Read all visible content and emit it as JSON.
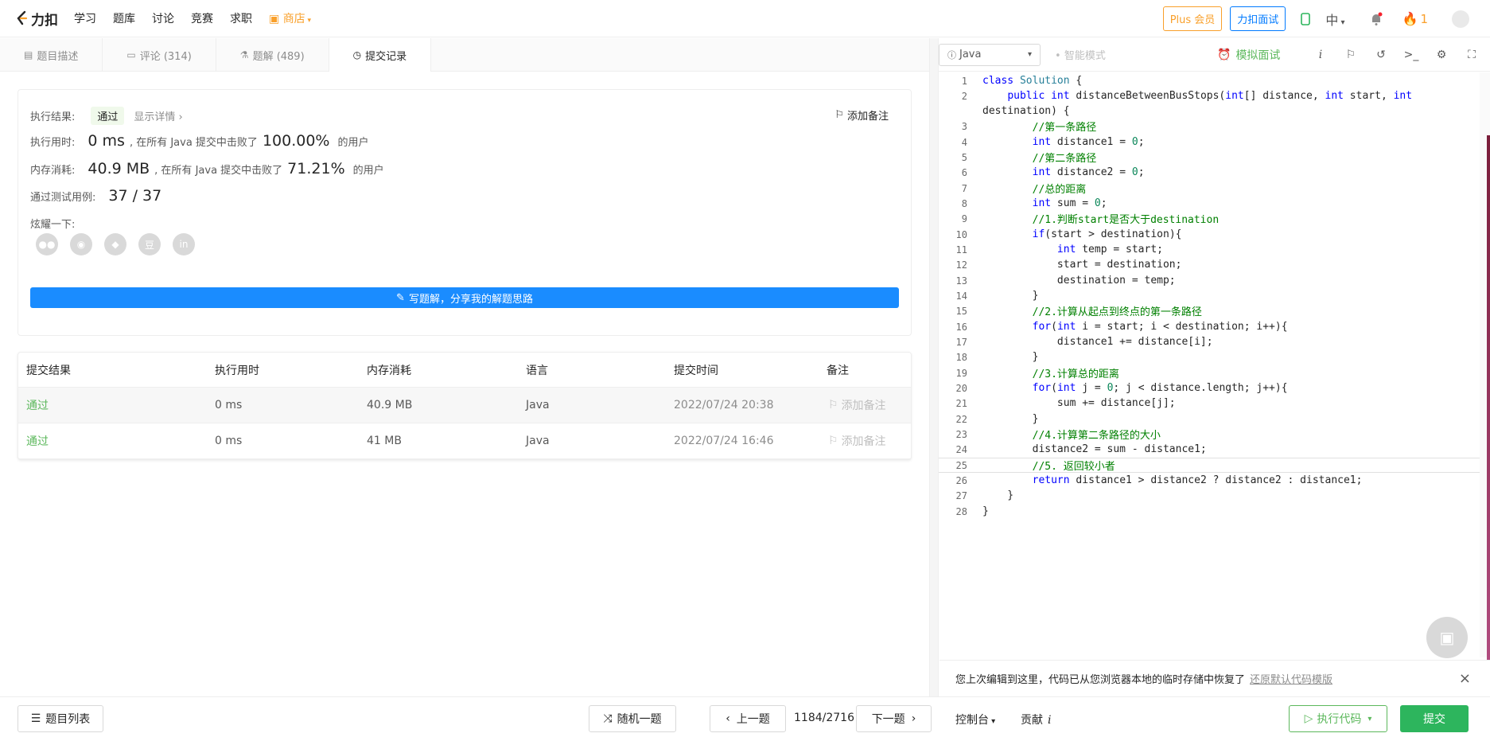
{
  "nav": {
    "logo_text": "力扣",
    "links": [
      "学习",
      "题库",
      "讨论",
      "竞赛",
      "求职"
    ],
    "shop": "商店",
    "plus": "Plus 会员",
    "interview": "力扣面试",
    "lang": "中",
    "fire_count": "1"
  },
  "tabs": [
    {
      "label": "题目描述"
    },
    {
      "label": "评论 (314)"
    },
    {
      "label": "题解 (489)"
    },
    {
      "label": "提交记录"
    }
  ],
  "result": {
    "status_label": "执行结果:",
    "status": "通过",
    "detail": "显示详情 ›",
    "add_note": "添加备注",
    "time_label": "执行用时:",
    "time_value": "0 ms",
    "time_mid": ", 在所有 Java 提交中击败了",
    "time_pct": "100.00%",
    "time_suffix": "的用户",
    "mem_label": "内存消耗:",
    "mem_value": "40.9 MB",
    "mem_mid": ", 在所有 Java 提交中击败了",
    "mem_pct": "71.21%",
    "mem_suffix": "的用户",
    "tests_label": "通过测试用例:",
    "tests_value": "37 / 37",
    "share_label": "炫耀一下:",
    "write_btn": "写题解，分享我的解题思路"
  },
  "subs": {
    "headers": [
      "提交结果",
      "执行用时",
      "内存消耗",
      "语言",
      "提交时间",
      "备注"
    ],
    "rows": [
      {
        "result": "通过",
        "time": "0 ms",
        "mem": "40.9 MB",
        "lang": "Java",
        "when": "2022/07/24 20:38",
        "note": "添加备注"
      },
      {
        "result": "通过",
        "time": "0 ms",
        "mem": "41 MB",
        "lang": "Java",
        "when": "2022/07/24 16:46",
        "note": "添加备注"
      }
    ]
  },
  "editor": {
    "lang": "Java",
    "smart": "智能模式",
    "mock": "模拟面试",
    "restore_msg": "您上次编辑到这里，代码已从您浏览器本地的临时存储中恢复了",
    "restore_link": "还原默认代码模版"
  },
  "bottom": {
    "list": "题目列表",
    "random": "随机一题",
    "prev": "上一题",
    "counter": "1184/2716",
    "next": "下一题",
    "console": "控制台",
    "contrib": "贡献",
    "run": "执行代码",
    "submit": "提交"
  },
  "colors": {
    "pass": "#5cb85c",
    "accent": "#1a8cff",
    "submit": "#2db55d",
    "shop": "#f9a02b"
  }
}
